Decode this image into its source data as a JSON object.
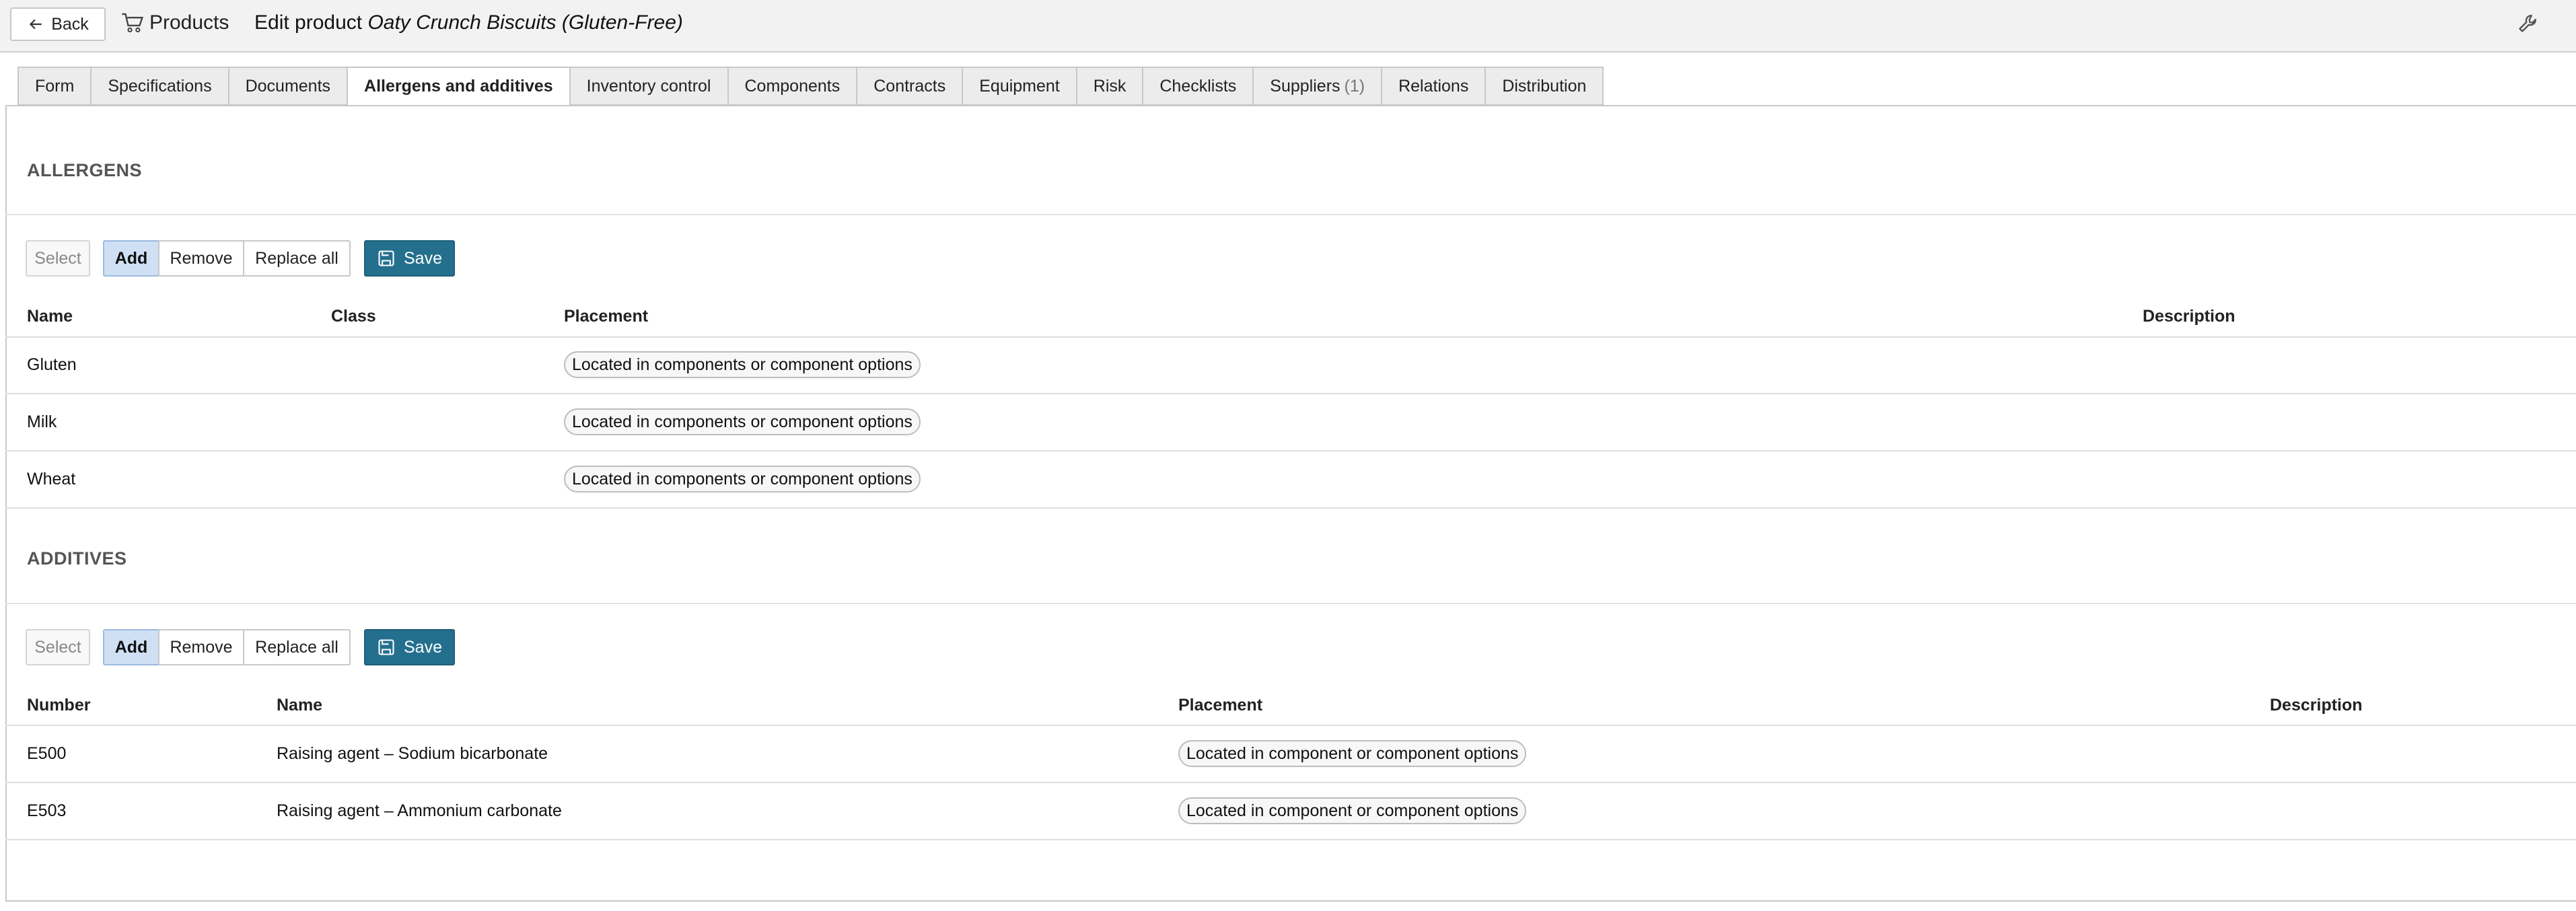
{
  "header": {
    "back_label": "Back",
    "breadcrumb_label": "Products",
    "title_prefix": "Edit product",
    "product_name": "Oaty Crunch Biscuits (Gluten-Free)"
  },
  "tabs": [
    {
      "label": "Form"
    },
    {
      "label": "Specifications"
    },
    {
      "label": "Documents"
    },
    {
      "label": "Allergens and additives",
      "active": true
    },
    {
      "label": "Inventory control"
    },
    {
      "label": "Components"
    },
    {
      "label": "Contracts"
    },
    {
      "label": "Equipment"
    },
    {
      "label": "Risk"
    },
    {
      "label": "Checklists"
    },
    {
      "label": "Suppliers",
      "count": "(1)"
    },
    {
      "label": "Relations"
    },
    {
      "label": "Distribution"
    }
  ],
  "allergens": {
    "title": "ALLERGENS",
    "toolbar": {
      "select": "Select",
      "add": "Add",
      "remove": "Remove",
      "replace_all": "Replace all",
      "save": "Save"
    },
    "columns": [
      "Name",
      "Class",
      "Placement",
      "Description"
    ],
    "rows": [
      {
        "name": "Gluten",
        "class": "",
        "placement": "Located in components or component options",
        "description": ""
      },
      {
        "name": "Milk",
        "class": "",
        "placement": "Located in components or component options",
        "description": ""
      },
      {
        "name": "Wheat",
        "class": "",
        "placement": "Located in components or component options",
        "description": ""
      }
    ]
  },
  "additives": {
    "title": "ADDITIVES",
    "toolbar": {
      "select": "Select",
      "add": "Add",
      "remove": "Remove",
      "replace_all": "Replace all",
      "save": "Save"
    },
    "columns": [
      "Number",
      "Name",
      "Placement",
      "Description"
    ],
    "rows": [
      {
        "number": "E500",
        "name": "Raising agent – Sodium bicarbonate",
        "placement": "Located in component or component options",
        "description": ""
      },
      {
        "number": "E503",
        "name": "Raising agent – Ammonium carbonate",
        "placement": "Located in component or component options",
        "description": ""
      }
    ]
  },
  "icons": {
    "back": "arrow-left-icon",
    "products": "shopping-cart-icon",
    "settings": "wrench-icon",
    "save": "save-icon"
  },
  "colors": {
    "save_button": "#246f8e",
    "active_segment": "#cfe0f5",
    "topbar": "#f2f2f2"
  }
}
